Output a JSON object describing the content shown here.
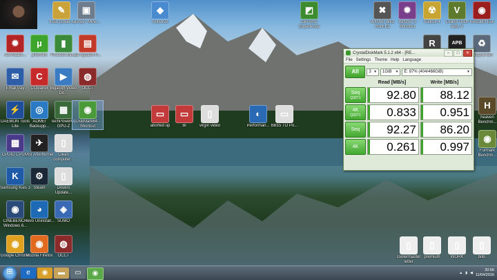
{
  "desktop_icons": [
    {
      "id": "i1",
      "label": "Kt58 (Steel...",
      "glyph": "✎",
      "color": "#c9a23a"
    },
    {
      "id": "i2",
      "label": "Bluray / Mine...",
      "glyph": "▣",
      "color": "#6d7d8e"
    },
    {
      "id": "i3",
      "label": "Antivirus",
      "glyph": "◆",
      "color": "#4a8bd0"
    },
    {
      "id": "i4",
      "label": "GeForce Experience",
      "glyph": "◩",
      "color": "#3d8b2f"
    },
    {
      "id": "i5",
      "label": "Witcher Wild Hunt E3",
      "glyph": "✖",
      "color": "#555"
    },
    {
      "id": "i6",
      "label": "Witcher 3 Shortcut",
      "glyph": "✹",
      "color": "#7a3f8a"
    },
    {
      "id": "i7",
      "label": "Fallout 4",
      "glyph": "☢",
      "color": "#c8a532"
    },
    {
      "id": "i8",
      "label": "Grand Theft Auto V",
      "glyph": "V",
      "color": "#5e7a2c"
    },
    {
      "id": "i9",
      "label": "Resident Evil",
      "glyph": "◉",
      "color": "#9a1e1e"
    },
    {
      "id": "i10",
      "label": "Ad-Aware...",
      "glyph": "✹",
      "color": "#b32424"
    },
    {
      "id": "i11",
      "label": "µTorrent",
      "glyph": "µ",
      "color": "#3da52b"
    },
    {
      "id": "i12",
      "label": "Process Mo...",
      "glyph": "▮",
      "color": "#3a8a3a"
    },
    {
      "id": "i13",
      "label": "Bit System 0...",
      "glyph": "▤",
      "color": "#c23a2a"
    },
    {
      "id": "i14",
      "label": "Rainmeter",
      "glyph": "R",
      "color": "#444"
    },
    {
      "id": "i15",
      "label": "APB Reloaded",
      "glyph": "APB",
      "color": "#222"
    },
    {
      "id": "i16",
      "label": "Recycle Bin",
      "glyph": "♻",
      "color": "#5a6a7a"
    },
    {
      "id": "i17",
      "label": "EmailTray",
      "glyph": "✉",
      "color": "#2e5ea8"
    },
    {
      "id": "i18",
      "label": "CCleaner",
      "glyph": "C",
      "color": "#c62a2a"
    },
    {
      "id": "i19",
      "label": "Bigasoft Video Do...",
      "glyph": "▶",
      "color": "#3b7bc2"
    },
    {
      "id": "i20",
      "label": "OCCT",
      "glyph": "◍",
      "color": "#8a2a2a"
    },
    {
      "id": "i21",
      "label": "DAEMON Tools Lite",
      "glyph": "⚡",
      "color": "#1f4f9a"
    },
    {
      "id": "i22",
      "label": "AOMEI Backupp...",
      "glyph": "◎",
      "color": "#2a7ac4"
    },
    {
      "id": "i23",
      "label": "TechPowerUp GPU-Z",
      "glyph": "▦",
      "color": "#3a6a3a"
    },
    {
      "id": "i24",
      "label": "DiskMark64 - Shortcut",
      "glyph": "◉",
      "color": "#4a9a3a",
      "selected": true
    },
    {
      "id": "i25",
      "label": "aborted up",
      "glyph": "▭",
      "color": "#c23a3a"
    },
    {
      "id": "i26",
      "label": "Bi",
      "glyph": "▭",
      "color": "#c23a3a"
    },
    {
      "id": "i27",
      "label": "virgin video",
      "glyph": "▯",
      "color": "#ddd"
    },
    {
      "id": "i28",
      "label": "Performan...",
      "glyph": "◐",
      "color": "#2a6ab4"
    },
    {
      "id": "i29",
      "label": "BB15 TO Po...",
      "glyph": "▭",
      "color": "#ddd"
    },
    {
      "id": "i30",
      "label": "CPUID CPU-Z",
      "glyph": "▩",
      "color": "#4a3a8a"
    },
    {
      "id": "i31",
      "label": "MSI Afterburner",
      "glyph": "✈",
      "color": "#222"
    },
    {
      "id": "i32",
      "label": "Clean computer...",
      "glyph": "▯",
      "color": "#ddd"
    },
    {
      "id": "i33",
      "label": "Samsung Kies 3",
      "glyph": "K",
      "color": "#1f5aa8"
    },
    {
      "id": "i34",
      "label": "Steam",
      "glyph": "⚙",
      "color": "#1b2838"
    },
    {
      "id": "i35",
      "label": "Drivers Update...",
      "glyph": "▯",
      "color": "#ddd"
    },
    {
      "id": "i36",
      "label": "CINEBENCH Windows 6...",
      "glyph": "◉",
      "color": "#2a4a7a"
    },
    {
      "id": "i37",
      "label": "Revo Uninstall...",
      "glyph": "◕",
      "color": "#1f6ab4"
    },
    {
      "id": "i38",
      "label": "SUMO",
      "glyph": "◈",
      "color": "#3a6ab4"
    },
    {
      "id": "i39",
      "label": "Google Chrome",
      "glyph": "◉",
      "color": "#e0a020"
    },
    {
      "id": "i40",
      "label": "Mozilla Firefox",
      "glyph": "◉",
      "color": "#e06a20"
    },
    {
      "id": "i41",
      "label": "OCCT",
      "glyph": "◍",
      "color": "#8a2a2a"
    },
    {
      "id": "i42",
      "label": "coolermaster letter",
      "glyph": "▯",
      "color": "#eee"
    },
    {
      "id": "i43",
      "label": "premium",
      "glyph": "▯",
      "color": "#eee"
    },
    {
      "id": "i44",
      "label": "WORK",
      "glyph": "▯",
      "color": "#eee"
    },
    {
      "id": "i45",
      "label": "bills",
      "glyph": "▯",
      "color": "#eee"
    },
    {
      "id": "i46",
      "label": "heaven Benchm...",
      "glyph": "H",
      "color": "#5a4a2a"
    },
    {
      "id": "i47",
      "label": "Furmark Benchm...",
      "glyph": "◉",
      "color": "#6a8a3a"
    }
  ],
  "cdm": {
    "title": "CrystalDiskMark 5.1.2 x64 - [RE...",
    "menu": [
      "File",
      "Settings",
      "Theme",
      "Help",
      "Language"
    ],
    "all_label": "All",
    "count": "3",
    "size": "1GiB",
    "drive": "E: 87% (404/466GiB)",
    "read_header": "Read [MB/s]",
    "write_header": "Write [MB/s]",
    "rows": [
      {
        "label": "Seq",
        "sub": "Q32T1",
        "read": "92.80",
        "write": "88.12",
        "read_frac": 0.03,
        "write_frac": 0.03
      },
      {
        "label": "4K",
        "sub": "Q32T1",
        "read": "0.833",
        "write": "0.951",
        "read_frac": 0.02,
        "write_frac": 0.02
      },
      {
        "label": "Seq",
        "sub": "",
        "read": "92.27",
        "write": "86.20",
        "read_frac": 0.03,
        "write_frac": 0.03
      },
      {
        "label": "4K",
        "sub": "",
        "read": "0.261",
        "write": "0.997",
        "read_frac": 0.02,
        "write_frac": 0.02
      }
    ]
  },
  "taskbar": {
    "items": [
      "ie",
      "chrome",
      "folder",
      "media",
      "cdm"
    ],
    "time": "20:56",
    "date": "11/04/2016"
  }
}
